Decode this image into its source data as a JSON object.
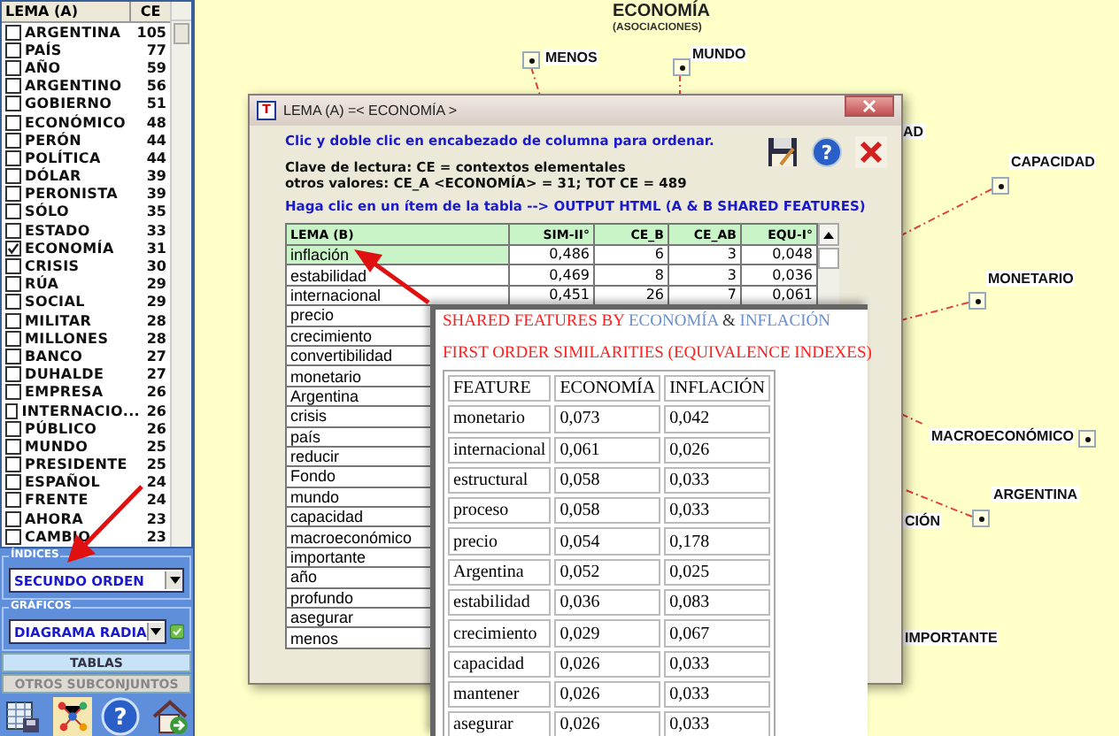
{
  "sidebar": {
    "list": {
      "columns": [
        "LEMA (A)",
        "CE"
      ],
      "items": [
        {
          "label": "ARGENTINA",
          "count": "105",
          "checked": false
        },
        {
          "label": "PAÍS",
          "count": "77",
          "checked": false
        },
        {
          "label": "AÑO",
          "count": "59",
          "checked": false
        },
        {
          "label": "ARGENTINO",
          "count": "56",
          "checked": false
        },
        {
          "label": "GOBIERNO",
          "count": "51",
          "checked": false
        },
        {
          "label": "ECONÓMICO",
          "count": "48",
          "checked": false
        },
        {
          "label": "PERÓN",
          "count": "44",
          "checked": false
        },
        {
          "label": "POLÍTICA",
          "count": "44",
          "checked": false
        },
        {
          "label": "DÓLAR",
          "count": "39",
          "checked": false
        },
        {
          "label": "PERONISTA",
          "count": "39",
          "checked": false
        },
        {
          "label": "SÓLO",
          "count": "35",
          "checked": false
        },
        {
          "label": "ESTADO",
          "count": "33",
          "checked": false
        },
        {
          "label": "ECONOMÍA",
          "count": "31",
          "checked": true
        },
        {
          "label": "CRISIS",
          "count": "30",
          "checked": false
        },
        {
          "label": "RÚA",
          "count": "29",
          "checked": false
        },
        {
          "label": "SOCIAL",
          "count": "29",
          "checked": false
        },
        {
          "label": "MILITAR",
          "count": "28",
          "checked": false
        },
        {
          "label": "MILLONES",
          "count": "28",
          "checked": false
        },
        {
          "label": "BANCO",
          "count": "27",
          "checked": false
        },
        {
          "label": "DUHALDE",
          "count": "27",
          "checked": false
        },
        {
          "label": "EMPRESA",
          "count": "26",
          "checked": false
        },
        {
          "label": "INTERNACIO...",
          "count": "26",
          "checked": false
        },
        {
          "label": "PÚBLICO",
          "count": "26",
          "checked": false
        },
        {
          "label": "MUNDO",
          "count": "25",
          "checked": false
        },
        {
          "label": "PRESIDENTE",
          "count": "25",
          "checked": false
        },
        {
          "label": "ESPAÑOL",
          "count": "24",
          "checked": false
        },
        {
          "label": "FRENTE",
          "count": "24",
          "checked": false
        },
        {
          "label": "AHORA",
          "count": "23",
          "checked": false
        },
        {
          "label": "CAMBIO",
          "count": "23",
          "checked": false
        }
      ]
    },
    "indices": {
      "legend": "ÍNDICES",
      "value": "SECUNDO ORDEN"
    },
    "graficos": {
      "legend": "GRÁFICOS",
      "value": "DIAGRAMA RADIA"
    },
    "buttons": [
      {
        "label": "TABLAS",
        "disabled": false
      },
      {
        "label": "OTROS SUBCONJUNTOS",
        "disabled": true
      }
    ],
    "help_glyph": "?"
  },
  "diagram": {
    "title": "ECONOMÍA",
    "subtitle": "(ASOCIACIONES)",
    "nodes": [
      {
        "label": "MENOS",
        "kind": "node"
      },
      {
        "label": "MUNDO",
        "kind": "node"
      },
      {
        "label": "AD",
        "kind": "partial"
      },
      {
        "label": "CAPACIDAD",
        "kind": "node"
      },
      {
        "label": "MONETARIO",
        "kind": "node"
      },
      {
        "label": "MACROECONÓMICO",
        "kind": "node"
      },
      {
        "label": "CIÓN",
        "kind": "partial"
      },
      {
        "label": "ARGENTINA",
        "kind": "node"
      },
      {
        "label": "IMPORTANTE",
        "kind": "partial"
      }
    ]
  },
  "dialog": {
    "app_icon": "T",
    "help_glyph": "?",
    "title": "LEMA (A) =< ECONOMÍA >",
    "hint": "Clic y doble clic en encabezado de columna para ordenar.",
    "key_lines": [
      "Clave de lectura: CE = contextos elementales",
      "otros valores: CE_A <ECONOMÍA> = 31; TOT CE = 489"
    ],
    "link_hint": "Haga clic en un ítem de la tabla --> OUTPUT HTML (A & B SHARED FEATURES)",
    "table": {
      "columns": [
        "LEMA (B)",
        "SIM-II°",
        "CE_B",
        "CE_AB",
        "EQU-I°"
      ],
      "rows": [
        {
          "cells": [
            "inflación",
            "0,486",
            "6",
            "3",
            "0,048"
          ],
          "selected": true
        },
        {
          "cells": [
            "estabilidad",
            "0,469",
            "8",
            "3",
            "0,036"
          ],
          "selected": false
        },
        {
          "cells": [
            "internacional",
            "0,451",
            "26",
            "7",
            "0,061"
          ],
          "selected": false
        },
        {
          "cells": [
            "precio"
          ],
          "selected": false
        },
        {
          "cells": [
            "crecimiento"
          ],
          "selected": false
        },
        {
          "cells": [
            "convertibilidad"
          ],
          "selected": false
        },
        {
          "cells": [
            "monetario"
          ],
          "selected": false
        },
        {
          "cells": [
            "Argentina"
          ],
          "selected": false
        },
        {
          "cells": [
            "crisis"
          ],
          "selected": false
        },
        {
          "cells": [
            "país"
          ],
          "selected": false
        },
        {
          "cells": [
            "reducir"
          ],
          "selected": false
        },
        {
          "cells": [
            "Fondo"
          ],
          "selected": false
        },
        {
          "cells": [
            "mundo"
          ],
          "selected": false
        },
        {
          "cells": [
            "capacidad"
          ],
          "selected": false
        },
        {
          "cells": [
            "macroeconómico"
          ],
          "selected": false
        },
        {
          "cells": [
            "importante"
          ],
          "selected": false
        },
        {
          "cells": [
            "año"
          ],
          "selected": false
        },
        {
          "cells": [
            "profundo"
          ],
          "selected": false
        },
        {
          "cells": [
            "asegurar"
          ],
          "selected": false
        },
        {
          "cells": [
            "menos"
          ],
          "selected": false
        }
      ]
    }
  },
  "html_window": {
    "heading": [
      {
        "text": "SHARED FEATURES BY ",
        "kind": "label"
      },
      {
        "text": "ECONOMÍA",
        "kind": "term"
      },
      {
        "text": " & ",
        "kind": "joiner"
      },
      {
        "text": "INFLACIÓN",
        "kind": "term"
      }
    ],
    "subheading": "FIRST ORDER SIMILARITIES (EQUIVALENCE INDEXES)",
    "table": {
      "columns": [
        "FEATURE",
        "ECONOMÍA",
        "INFLACIÓN"
      ],
      "rows": [
        [
          "monetario",
          "0,073",
          "0,042"
        ],
        [
          "internacional",
          "0,061",
          "0,026"
        ],
        [
          "estructural",
          "0,058",
          "0,033"
        ],
        [
          "proceso",
          "0,058",
          "0,033"
        ],
        [
          "precio",
          "0,054",
          "0,178"
        ],
        [
          "Argentina",
          "0,052",
          "0,025"
        ],
        [
          "estabilidad",
          "0,036",
          "0,083"
        ],
        [
          "crecimiento",
          "0,029",
          "0,067"
        ],
        [
          "capacidad",
          "0,026",
          "0,033"
        ],
        [
          "mantener",
          "0,026",
          "0,033"
        ],
        [
          "asegurar",
          "0,026",
          "0,033"
        ]
      ]
    }
  }
}
